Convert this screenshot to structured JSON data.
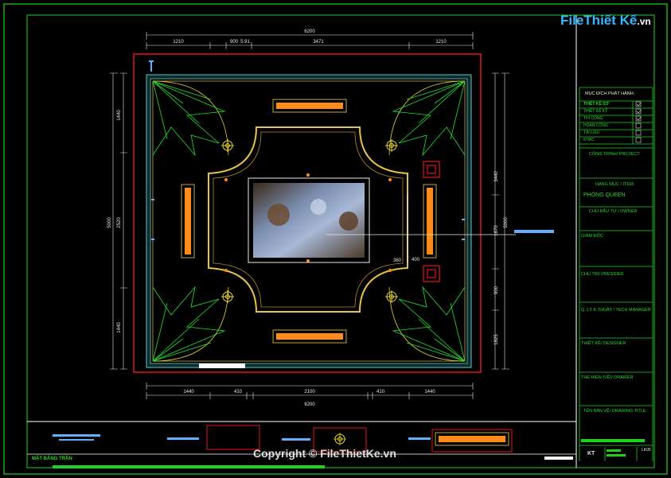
{
  "logo": {
    "file": "File",
    "thiet": "Thiết Kế",
    "tld": ".vn"
  },
  "watermark": "Copyright © FileThietKe.vn",
  "dimensions": {
    "top_total": "6200",
    "top_parts": [
      "1210",
      "900",
      "5.91",
      "3471",
      "1210"
    ],
    "bottom_total": "6200",
    "bottom_parts": [
      "1440",
      "410",
      "2100",
      "410",
      "1440"
    ],
    "left_total": "5000",
    "left_parts": [
      "1440",
      "2520",
      "1440"
    ],
    "right_total": "5000",
    "right_parts": [
      "3440",
      "1870",
      "900",
      "1825"
    ],
    "inner_small": [
      "360",
      "400"
    ]
  },
  "title_block": {
    "purpose_heading": "MỤC ĐÍCH PHÁT HÀNH:",
    "purpose_items": [
      {
        "label": "THIẾT KẾ SƠ",
        "checked": true
      },
      {
        "label": "THIẾT KẾ KỸ",
        "checked": true
      },
      {
        "label": "THI CÔNG",
        "checked": true
      },
      {
        "label": "HOÀN CÔNG",
        "checked": false
      },
      {
        "label": "TÀI LIỆU",
        "checked": false
      },
      {
        "label": "KHÁC",
        "checked": false
      }
    ],
    "project_label": "CÔNG TRÌNH/ PROJECT:",
    "item_label": "HẠNG MỤC / ITEM:",
    "item_value": "PHÒNG QUEEN",
    "owner_label": "CHỦ ĐẦU TƯ / OWNER:",
    "director_label": "GIÁM ĐỐC",
    "president_label": "CHỦ TRÌ/ PRESIDED",
    "tech_manager_label": "Q. LÝ K.THUẬT / TECH MANAGER",
    "designer_label": "THIẾT KẾ/ DESIGNER",
    "drawer_label": "THỂ HIỆN (VẼ)/ DRAWER",
    "drawing_title_label": "TÊN BẢN VẼ/ DRAWING TITLE:",
    "code_label": "KT",
    "sheet_label": "LK05"
  },
  "drawing_name": "MẶT BẰNG TRẦN",
  "colors": {
    "frame": "#1fd11f",
    "red": "#e11717",
    "yellow": "#e6d42e",
    "cyan": "#5fc6c6",
    "orange": "#ff8c1a"
  }
}
